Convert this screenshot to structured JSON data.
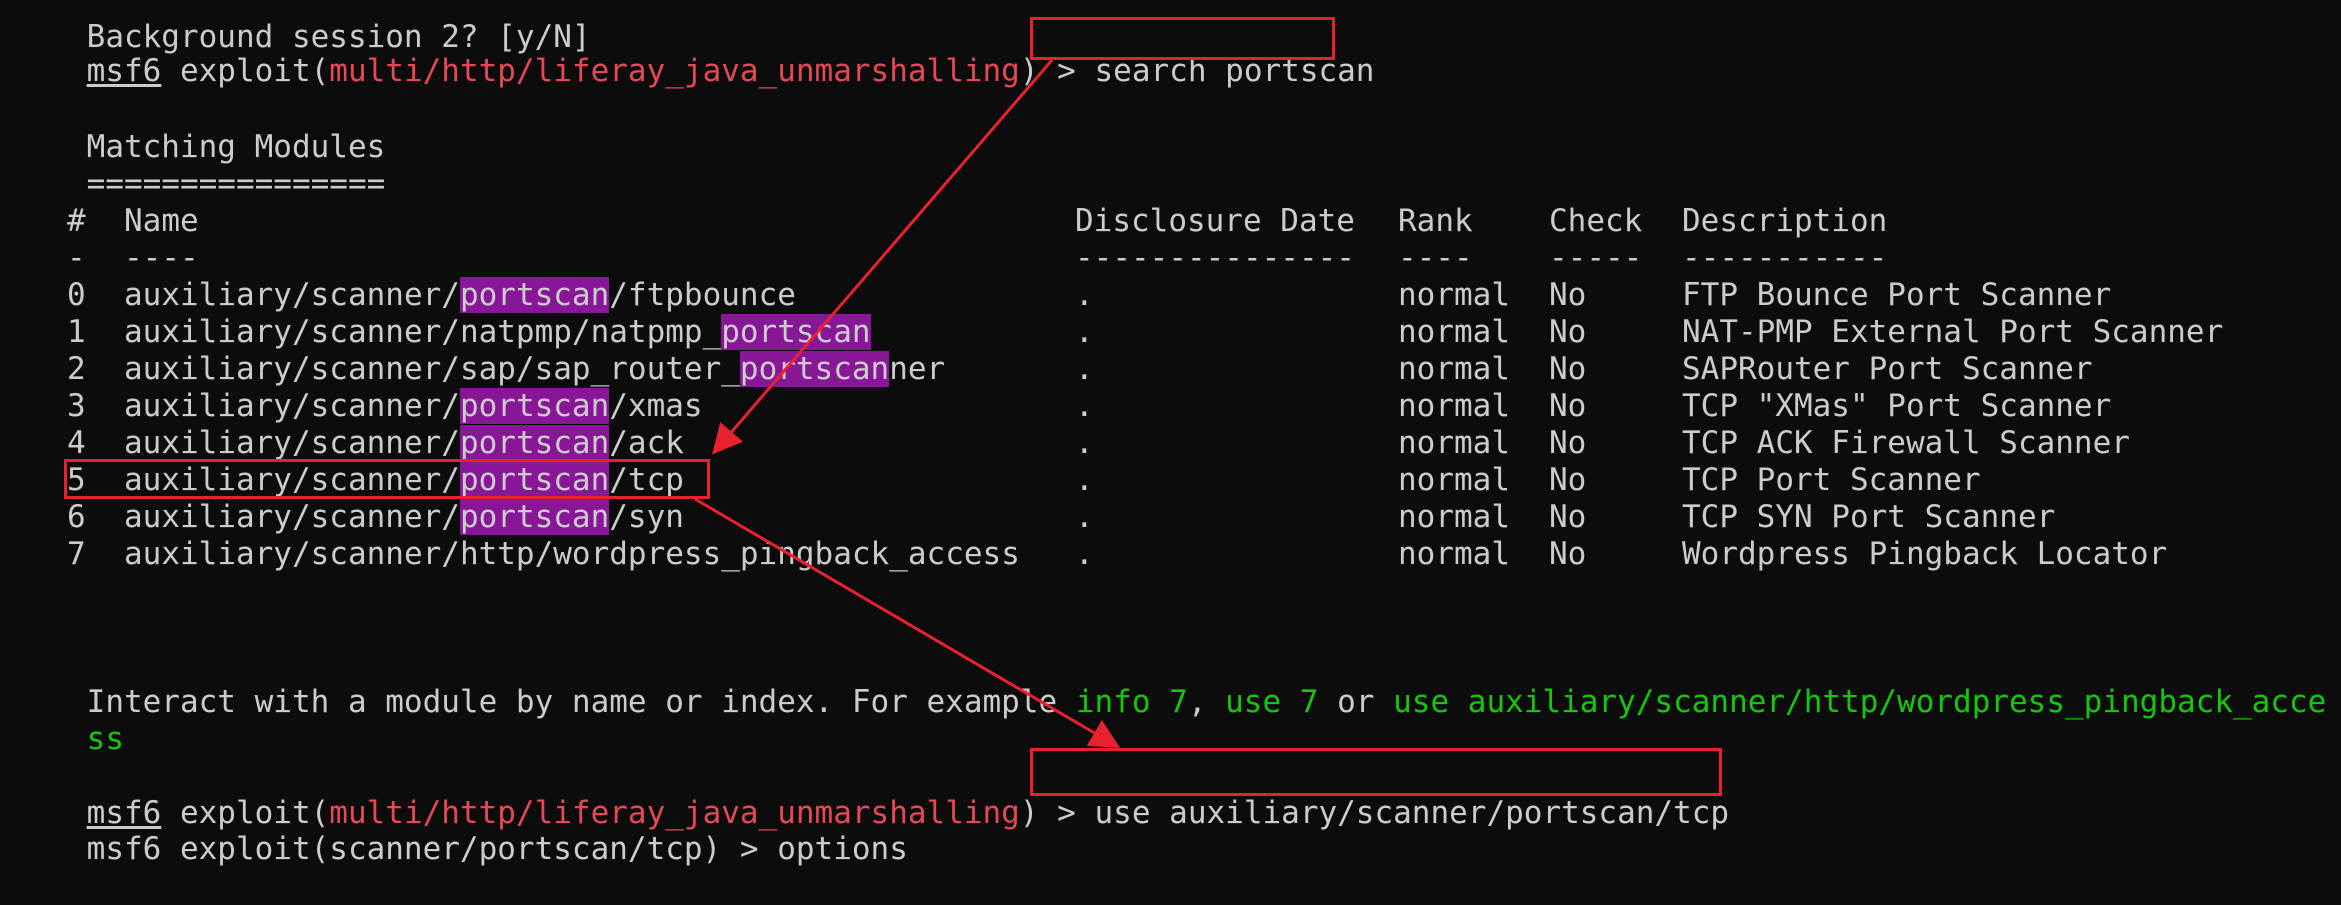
{
  "terminal": {
    "top_line": "Background session 2? [y/N]",
    "prompt1": {
      "prefix": "msf6",
      "exploit_open": " exploit(",
      "module": "multi/http/liferay_java_unmarshalling",
      "exploit_close": ") > ",
      "command": "search portscan"
    },
    "matching_title": "Matching Modules",
    "matching_rule": "================",
    "table": {
      "headers": [
        "#",
        "Name",
        "Disclosure Date",
        "Rank",
        "Check",
        "Description"
      ],
      "underlines": [
        "-",
        "----",
        "---------------",
        "----",
        "-----",
        "-----------"
      ],
      "rows": [
        {
          "idx": "0",
          "name_pre": "auxiliary/scanner/",
          "name_hl": "portscan",
          "name_post": "/ftpbounce",
          "date": ".",
          "rank": "normal",
          "check": "No",
          "desc": "FTP Bounce Port Scanner"
        },
        {
          "idx": "1",
          "name_pre": "auxiliary/scanner/natpmp/natpmp_",
          "name_hl": "portscan",
          "name_post": "",
          "date": ".",
          "rank": "normal",
          "check": "No",
          "desc": "NAT-PMP External Port Scanner"
        },
        {
          "idx": "2",
          "name_pre": "auxiliary/scanner/sap/sap_router_",
          "name_hl": "portscan",
          "name_post": "ner",
          "date": ".",
          "rank": "normal",
          "check": "No",
          "desc": "SAPRouter Port Scanner"
        },
        {
          "idx": "3",
          "name_pre": "auxiliary/scanner/",
          "name_hl": "portscan",
          "name_post": "/xmas",
          "date": ".",
          "rank": "normal",
          "check": "No",
          "desc": "TCP \"XMas\" Port Scanner"
        },
        {
          "idx": "4",
          "name_pre": "auxiliary/scanner/",
          "name_hl": "portscan",
          "name_post": "/ack",
          "date": ".",
          "rank": "normal",
          "check": "No",
          "desc": "TCP ACK Firewall Scanner"
        },
        {
          "idx": "5",
          "name_pre": "auxiliary/scanner/",
          "name_hl": "portscan",
          "name_post": "/tcp",
          "date": ".",
          "rank": "normal",
          "check": "No",
          "desc": "TCP Port Scanner"
        },
        {
          "idx": "6",
          "name_pre": "auxiliary/scanner/",
          "name_hl": "portscan",
          "name_post": "/syn",
          "date": ".",
          "rank": "normal",
          "check": "No",
          "desc": "TCP SYN Port Scanner"
        },
        {
          "idx": "7",
          "name_pre": "auxiliary/scanner/http/wordpress_pingback_access",
          "name_hl": "",
          "name_post": "",
          "date": ".",
          "rank": "normal",
          "check": "No",
          "desc": "Wordpress Pingback Locator"
        }
      ]
    },
    "interact": {
      "text1": "Interact with a module by name or index. For example ",
      "cmd1": "info 7",
      "sep1": ", ",
      "cmd2": "use 7",
      "sep2": " or ",
      "cmd3_line1": "use auxiliary/scanner/http/wordpress_pingback_acce",
      "cmd3_line2": "ss"
    },
    "prompt2": {
      "prefix": "msf6",
      "exploit_open": " exploit(",
      "module": "multi/http/liferay_java_unmarshalling",
      "exploit_close": ") > ",
      "command": "use auxiliary/scanner/portscan/tcp"
    },
    "bottom_line": "msf6 exploit(scanner/portscan/tcp) > options"
  },
  "colors": {
    "background": "#0c0c0c",
    "text": "#cccccc",
    "module": "#e74856",
    "command_hint": "#16c60c",
    "highlight": "#881798",
    "annotation": "#e8212e"
  }
}
